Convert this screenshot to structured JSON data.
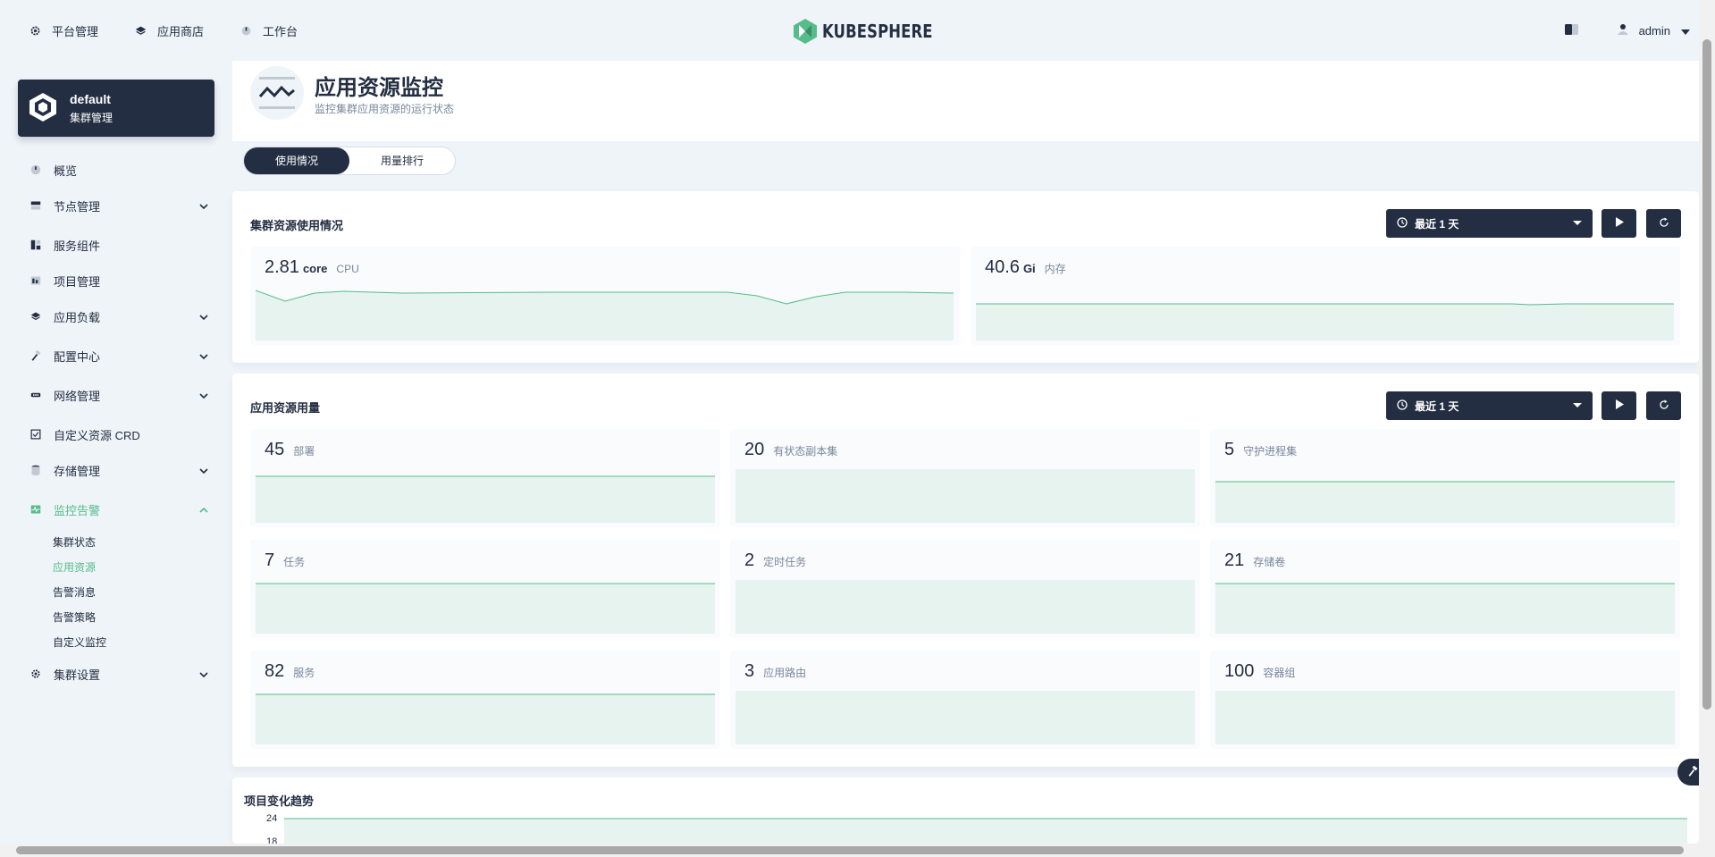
{
  "topnav": {
    "items": [
      {
        "label": "平台管理",
        "icon": "gear-icon"
      },
      {
        "label": "应用商店",
        "icon": "layers-icon"
      },
      {
        "label": "工作台",
        "icon": "dashboard-icon"
      }
    ],
    "logo_text": "KUBESPHERE",
    "user": "admin"
  },
  "cluster": {
    "name": "default",
    "subtitle": "集群管理"
  },
  "sidebar": {
    "items": [
      {
        "label": "概览",
        "icon": "dashboard-icon"
      },
      {
        "label": "节点管理",
        "icon": "nodes-icon"
      },
      {
        "label": "服务组件",
        "icon": "components-icon"
      },
      {
        "label": "项目管理",
        "icon": "project-icon"
      },
      {
        "label": "应用负载",
        "icon": "layers-icon"
      },
      {
        "label": "配置中心",
        "icon": "hammer-icon"
      },
      {
        "label": "网络管理",
        "icon": "network-icon"
      },
      {
        "label": "自定义资源 CRD",
        "icon": "crd-icon"
      },
      {
        "label": "存储管理",
        "icon": "database-icon"
      },
      {
        "label": "监控告警",
        "icon": "monitor-icon"
      },
      {
        "label": "集群设置",
        "icon": "gear-icon"
      }
    ],
    "monitor_sub": [
      "集群状态",
      "应用资源",
      "告警消息",
      "告警策略",
      "自定义监控"
    ],
    "active_color": "#55bc8a"
  },
  "page": {
    "title": "应用资源监控",
    "desc": "监控集群应用资源的运行状态"
  },
  "tabs": [
    "使用情况",
    "用量排行"
  ],
  "cluster_usage": {
    "title": "集群资源使用情况",
    "range": "最近 1 天",
    "cpu": {
      "value": "2.81",
      "unit": "core",
      "label": "CPU"
    },
    "memory": {
      "value": "40.6",
      "unit": "Gi",
      "label": "内存"
    }
  },
  "app_usage": {
    "title": "应用资源用量",
    "range": "最近 1 天",
    "metrics": [
      {
        "value": "45",
        "label": "部署"
      },
      {
        "value": "20",
        "label": "有状态副本集"
      },
      {
        "value": "5",
        "label": "守护进程集"
      },
      {
        "value": "7",
        "label": "任务"
      },
      {
        "value": "2",
        "label": "定时任务"
      },
      {
        "value": "21",
        "label": "存储卷"
      },
      {
        "value": "82",
        "label": "服务"
      },
      {
        "value": "3",
        "label": "应用路由"
      },
      {
        "value": "100",
        "label": "容器组"
      }
    ]
  },
  "trend": {
    "title": "项目变化趋势",
    "ticks": [
      "24",
      "18"
    ]
  },
  "colors": {
    "dark": "#242e42",
    "green": "#55bc8a",
    "muted": "#79879c",
    "bg": "#eff4f9"
  }
}
